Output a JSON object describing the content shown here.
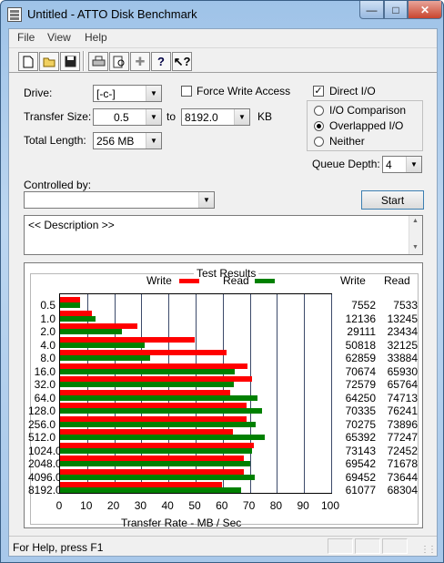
{
  "window": {
    "title": "Untitled - ATTO Disk Benchmark"
  },
  "menu": {
    "file": "File",
    "view": "View",
    "help": "Help"
  },
  "toolbar": {
    "icons": [
      "new-icon",
      "open-icon",
      "save-icon",
      "print-icon",
      "print-preview-icon",
      "move-icon",
      "help-icon",
      "context-help-icon"
    ]
  },
  "form": {
    "drive_label": "Drive:",
    "drive_value": "[-c-]",
    "force_write_label": "Force Write Access",
    "force_write_checked": false,
    "direct_io_label": "Direct I/O",
    "direct_io_checked": true,
    "transfer_size_label": "Transfer Size:",
    "transfer_from": "0.5",
    "to_label": "to",
    "transfer_to": "8192.0",
    "kb_label": "KB",
    "total_length_label": "Total Length:",
    "total_length_value": "256 MB",
    "io_comparison_label": "I/O Comparison",
    "overlapped_io_label": "Overlapped I/O",
    "neither_label": "Neither",
    "selected_mode": "Overlapped I/O",
    "queue_depth_label": "Queue Depth:",
    "queue_depth_value": "4",
    "controlled_by_label": "Controlled by:",
    "controlled_by_value": "",
    "start_label": "Start",
    "description": "<< Description >>"
  },
  "results": {
    "title": "Test Results",
    "write_legend": "Write",
    "read_legend": "Read",
    "write_col_header": "Write",
    "read_col_header": "Read",
    "x_title": "Transfer Rate - MB / Sec",
    "colors": {
      "write": "#ff0000",
      "read": "#008000"
    }
  },
  "chart_data": {
    "type": "bar",
    "orientation": "horizontal",
    "categories": [
      "0.5",
      "1.0",
      "2.0",
      "4.0",
      "8.0",
      "16.0",
      "32.0",
      "64.0",
      "128.0",
      "256.0",
      "512.0",
      "1024.0",
      "2048.0",
      "4096.0",
      "8192.0"
    ],
    "series": [
      {
        "name": "Write",
        "values": [
          7552,
          12136,
          29111,
          50818,
          62859,
          70674,
          72579,
          64250,
          70335,
          70275,
          65392,
          73143,
          69542,
          69452,
          61077
        ]
      },
      {
        "name": "Read",
        "values": [
          7533,
          13245,
          23434,
          32125,
          33884,
          65930,
          65764,
          74713,
          76241,
          73896,
          77247,
          72452,
          71678,
          73644,
          68304
        ]
      }
    ],
    "xlabel": "Transfer Rate - MB / Sec",
    "xlim": [
      0,
      100
    ],
    "xticks": [
      "0",
      "10",
      "20",
      "30",
      "40",
      "50",
      "60",
      "70",
      "80",
      "90",
      "100"
    ],
    "grid": true
  },
  "status": {
    "text": "For Help, press F1"
  }
}
